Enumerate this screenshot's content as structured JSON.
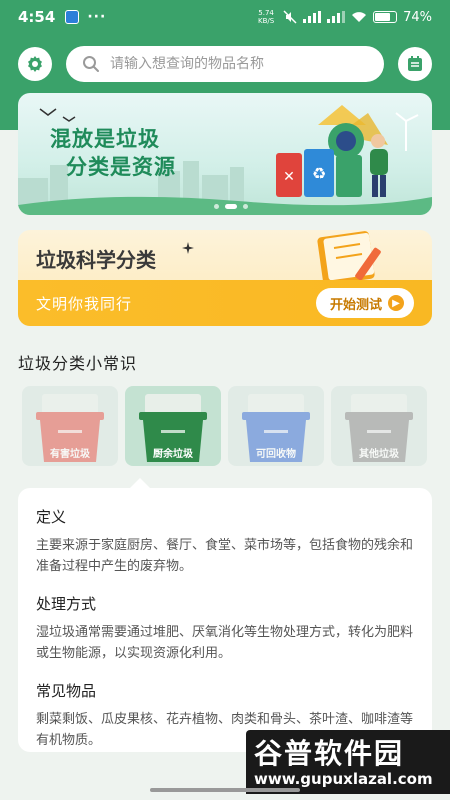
{
  "status": {
    "time": "4:54",
    "net_speed": "5.74 KB/S",
    "battery": "74",
    "battery_level": 0.74,
    "battery_suffix": "%"
  },
  "header": {
    "search_placeholder": "请输入想查询的物品名称",
    "settings_icon": "gear-icon",
    "notes_icon": "notepad-icon"
  },
  "banner": {
    "line1": "混放是垃圾",
    "line2": "分类是资源",
    "slide_count": 3,
    "active_slide": 1
  },
  "quiz": {
    "title": "垃圾科学分类",
    "subtitle": "文明你我同行",
    "button_label": "开始测试"
  },
  "tips": {
    "section_title": "垃圾分类小常识"
  },
  "bins": [
    {
      "label": "有害垃圾",
      "color": "#e05a4f",
      "selected": false
    },
    {
      "label": "厨余垃圾",
      "color": "#2f8a4a",
      "selected": true
    },
    {
      "label": "可回收物",
      "color": "#3c6fd1",
      "selected": false
    },
    {
      "label": "其他垃圾",
      "color": "#8c8c8c",
      "selected": false
    }
  ],
  "info": {
    "definition_title": "定义",
    "definition_text": "主要来源于家庭厨房、餐厅、食堂、菜市场等，包括食物的残余和准备过程中产生的废弃物。",
    "process_title": "处理方式",
    "process_text": "湿垃圾通常需要通过堆肥、厌氧消化等生物处理方式，转化为肥料或生物能源，以实现资源化利用。",
    "items_title": "常见物品",
    "items_text": "剩菜剩饭、瓜皮果核、花卉植物、肉类和骨头、茶叶渣、咖啡渣等有机物质。"
  },
  "watermark": {
    "title": "谷普软件园",
    "url": "www.gupuxlazal.com"
  },
  "colors": {
    "primary_green": "#3aa26a",
    "quiz_orange": "#fbbd2a"
  }
}
